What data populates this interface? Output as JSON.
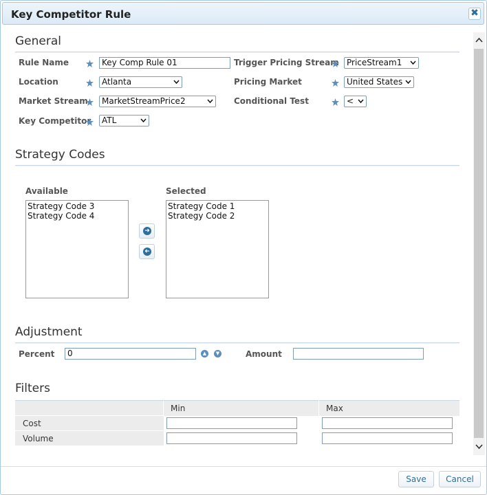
{
  "dialog": {
    "title": "Key Competitor Rule",
    "close_icon": "close-icon"
  },
  "general": {
    "section_title": "General",
    "rule_name_label": "Rule Name",
    "rule_name_value": "Key Comp Rule 01",
    "location_label": "Location",
    "location_value": "Atlanta",
    "market_stream_label": "Market Stream",
    "market_stream_value": "MarketStreamPrice2",
    "key_competitor_label": "Key Competitor",
    "key_competitor_value": "ATL",
    "trigger_pricing_stream_label": "Trigger Pricing Stream",
    "trigger_pricing_stream_value": "PriceStream1",
    "pricing_market_label": "Pricing Market",
    "pricing_market_value": "United States",
    "conditional_test_label": "Conditional Test",
    "conditional_test_value": "<"
  },
  "strategy": {
    "section_title": "Strategy Codes",
    "available_label": "Available",
    "available_items": [
      "Strategy Code 3",
      "Strategy Code 4"
    ],
    "selected_label": "Selected",
    "selected_items": [
      "Strategy Code 1",
      "Strategy Code 2"
    ]
  },
  "adjustment": {
    "section_title": "Adjustment",
    "percent_label": "Percent",
    "percent_value": "0",
    "amount_label": "Amount",
    "amount_value": ""
  },
  "filters": {
    "section_title": "Filters",
    "col_min": "Min",
    "col_max": "Max",
    "rows": [
      {
        "label": "Cost",
        "min": "",
        "max": ""
      },
      {
        "label": "Volume",
        "min": "",
        "max": ""
      }
    ]
  },
  "footer": {
    "save_label": "Save",
    "cancel_label": "Cancel"
  },
  "colors": {
    "accent": "#2e6e9e",
    "required_star": "#5b8fc0",
    "title_bar": "#dbeaf7"
  }
}
